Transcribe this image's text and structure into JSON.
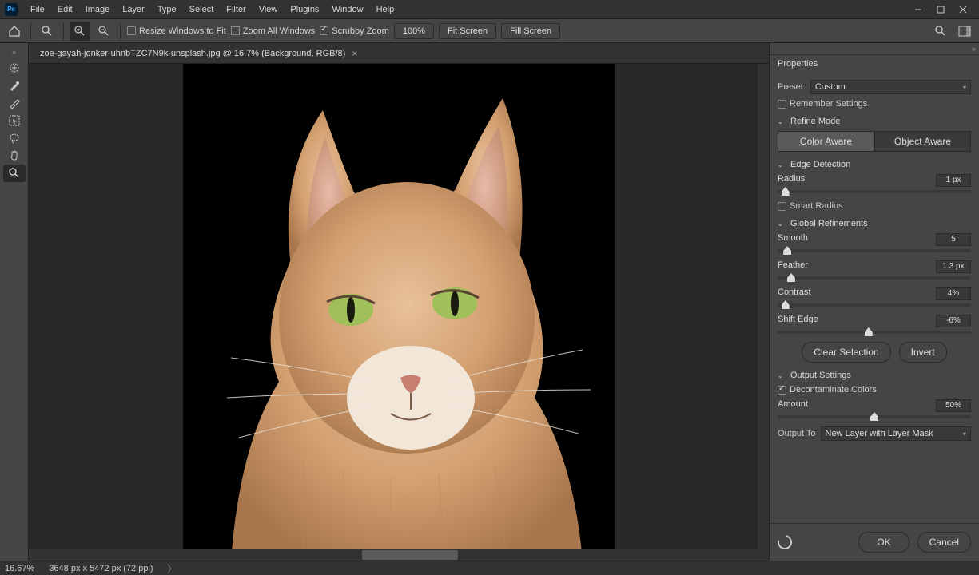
{
  "menu": {
    "items": [
      "File",
      "Edit",
      "Image",
      "Layer",
      "Type",
      "Select",
      "Filter",
      "View",
      "Plugins",
      "Window",
      "Help"
    ]
  },
  "options": {
    "resize_to_fit": "Resize Windows to Fit",
    "zoom_all": "Zoom All Windows",
    "scrubby": "Scrubby Zoom",
    "zoom_val": "100%",
    "fit_screen": "Fit Screen",
    "fill_screen": "Fill Screen"
  },
  "tab": {
    "title": "zoe-gayah-jonker-uhnbTZC7N9k-unsplash.jpg @ 16.7% (Background, RGB/8)"
  },
  "panel": {
    "title": "Properties",
    "preset_label": "Preset:",
    "preset_value": "Custom",
    "remember": "Remember Settings",
    "refine_mode": "Refine Mode",
    "color_aware": "Color Aware",
    "object_aware": "Object Aware",
    "edge_detection": "Edge Detection",
    "radius_label": "Radius",
    "radius_val": "1 px",
    "smart_radius": "Smart Radius",
    "global": "Global Refinements",
    "smooth_label": "Smooth",
    "smooth_val": "5",
    "feather_label": "Feather",
    "feather_val": "1.3 px",
    "contrast_label": "Contrast",
    "contrast_val": "4%",
    "shift_label": "Shift Edge",
    "shift_val": "-6%",
    "clear": "Clear Selection",
    "invert": "Invert",
    "output_settings": "Output Settings",
    "decontaminate": "Decontaminate Colors",
    "amount_label": "Amount",
    "amount_val": "50%",
    "output_to": "Output To",
    "output_val": "New Layer with Layer Mask",
    "ok": "OK",
    "cancel": "Cancel"
  },
  "status": {
    "zoom": "16.67%",
    "dims": "3648 px x 5472 px (72 ppi)"
  }
}
